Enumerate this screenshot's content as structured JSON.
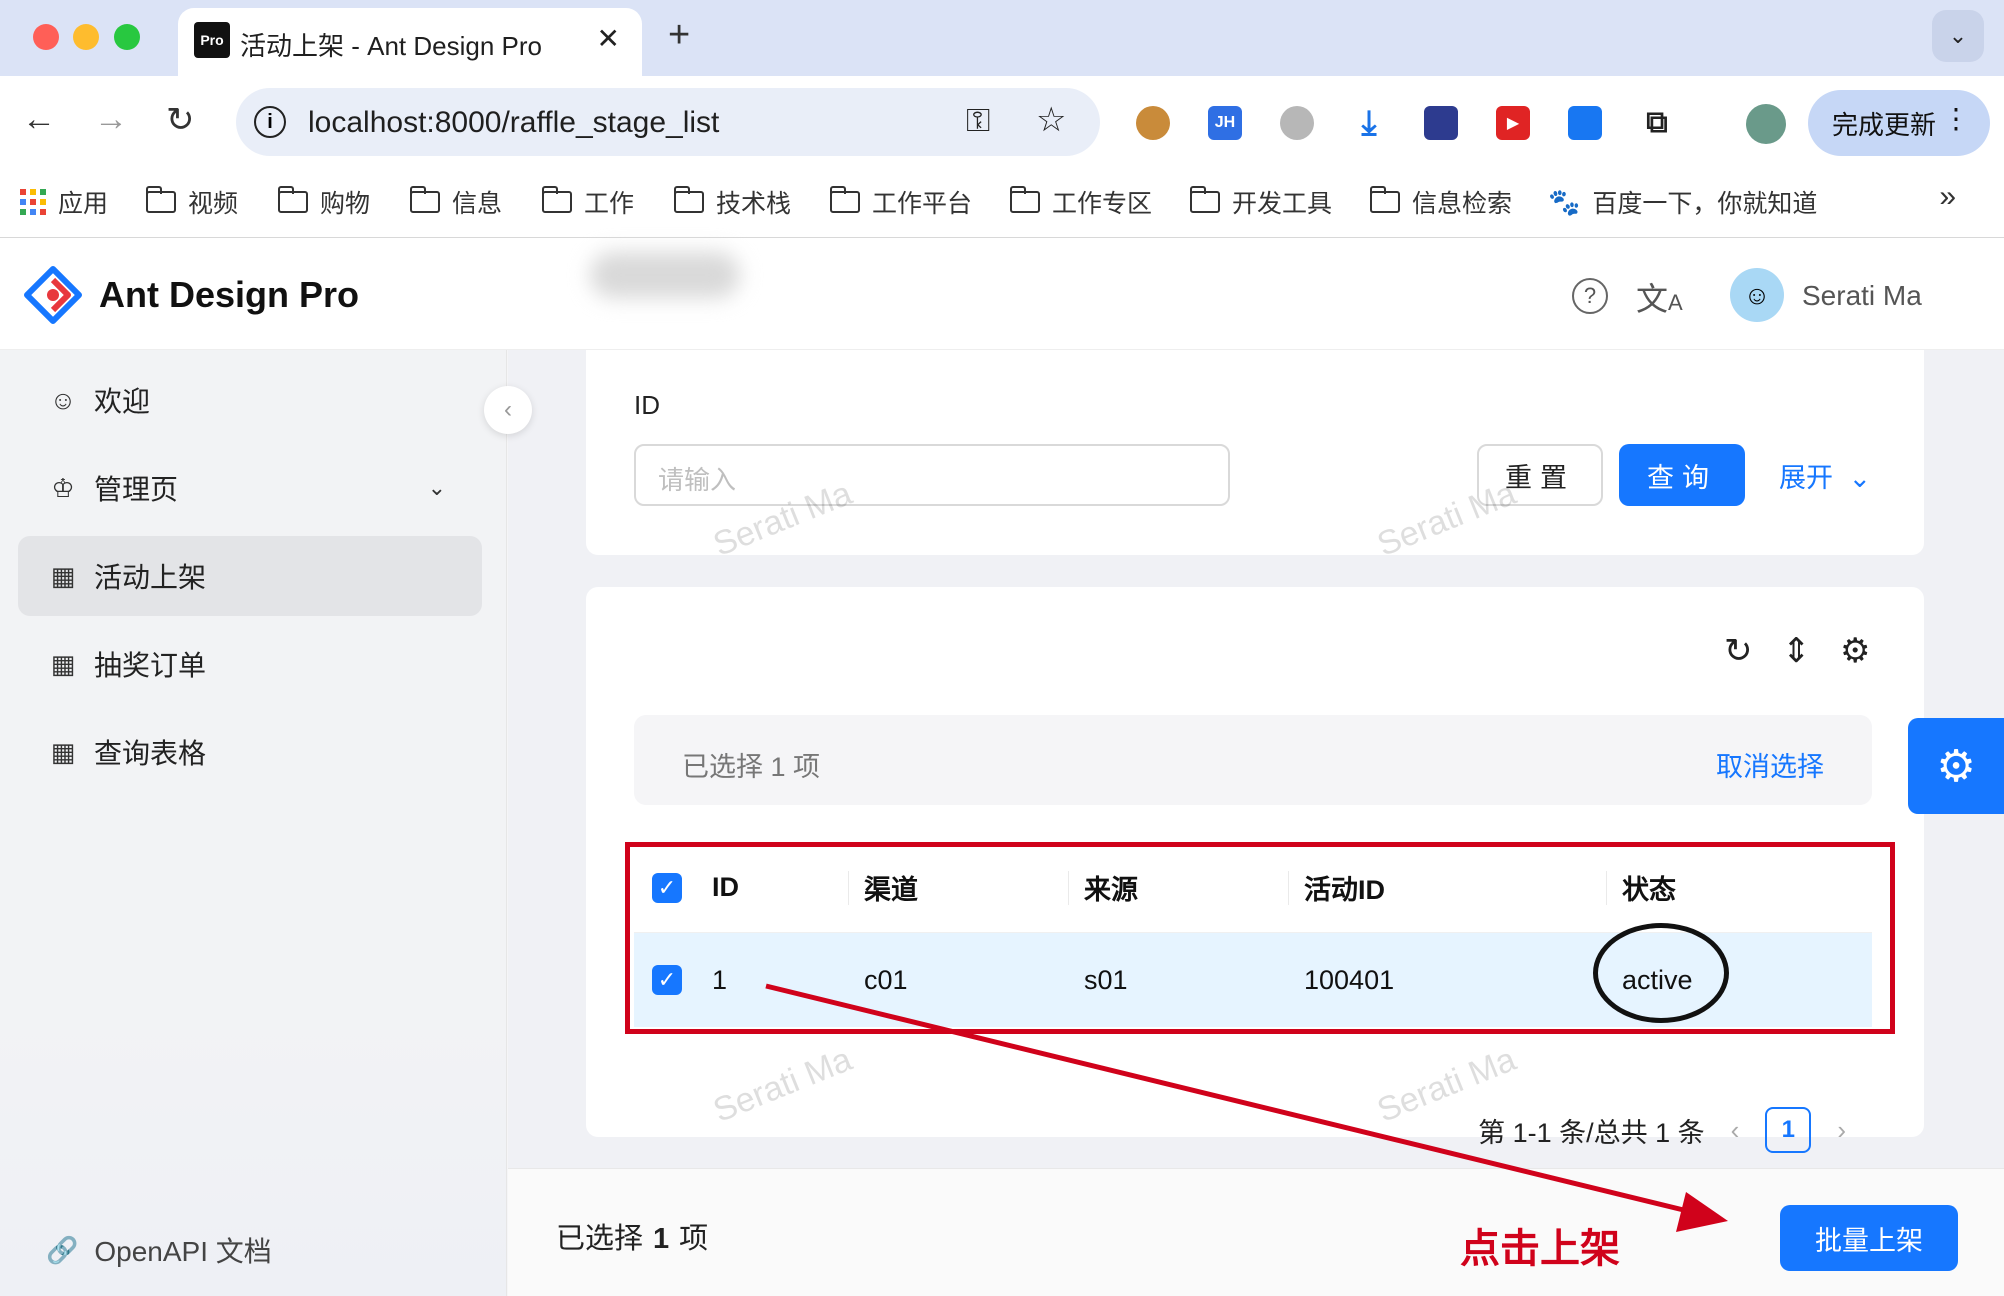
{
  "browser": {
    "tab_title": "活动上架 - Ant Design Pro",
    "tab_favicon_text": "Pro",
    "url": "localhost:8000/raffle_stage_list",
    "update_button": "完成更新"
  },
  "bookmarks": [
    {
      "label": "应用",
      "icon": "apps-icon"
    },
    {
      "label": "视频",
      "icon": "folder-icon"
    },
    {
      "label": "购物",
      "icon": "folder-icon"
    },
    {
      "label": "信息",
      "icon": "folder-icon"
    },
    {
      "label": "工作",
      "icon": "folder-icon"
    },
    {
      "label": "技术栈",
      "icon": "folder-icon"
    },
    {
      "label": "工作平台",
      "icon": "folder-icon"
    },
    {
      "label": "工作专区",
      "icon": "folder-icon"
    },
    {
      "label": "开发工具",
      "icon": "folder-icon"
    },
    {
      "label": "信息检索",
      "icon": "folder-icon"
    },
    {
      "label": "百度一下，你就知道",
      "icon": "baidu-icon"
    }
  ],
  "header": {
    "app_title": "Ant Design Pro",
    "user_name": "Serati Ma"
  },
  "sidebar": {
    "items": [
      {
        "label": "欢迎",
        "icon": "smile-icon"
      },
      {
        "label": "管理页",
        "icon": "crown-icon"
      },
      {
        "label": "活动上架",
        "icon": "table-icon",
        "active": true
      },
      {
        "label": "抽奖订单",
        "icon": "table-icon"
      },
      {
        "label": "查询表格",
        "icon": "table-icon"
      }
    ],
    "footer_link": "OpenAPI 文档"
  },
  "search_form": {
    "id_label": "ID",
    "id_placeholder": "请输入",
    "reset_label": "重置",
    "query_label": "查询",
    "expand_label": "展开"
  },
  "selection_alert": {
    "text": "已选择  1  项",
    "cancel_label": "取消选择"
  },
  "table": {
    "columns": [
      "ID",
      "渠道",
      "来源",
      "活动ID",
      "状态"
    ],
    "rows": [
      {
        "id": "1",
        "channel": "c01",
        "source": "s01",
        "activity_id": "100401",
        "status": "active",
        "selected": true
      }
    ]
  },
  "pagination": {
    "summary": "第 1-1 条/总共 1 条",
    "current_page": "1"
  },
  "footer": {
    "selected_prefix": "已选择",
    "selected_count": "1",
    "selected_suffix": "项",
    "batch_button": "批量上架"
  },
  "annotation": {
    "text": "点击上架",
    "color": "#d0021b"
  },
  "watermark": "Serati Ma",
  "colors": {
    "primary": "#1677ff",
    "selected_row": "#e6f4ff",
    "annotation_red": "#d0021b"
  }
}
